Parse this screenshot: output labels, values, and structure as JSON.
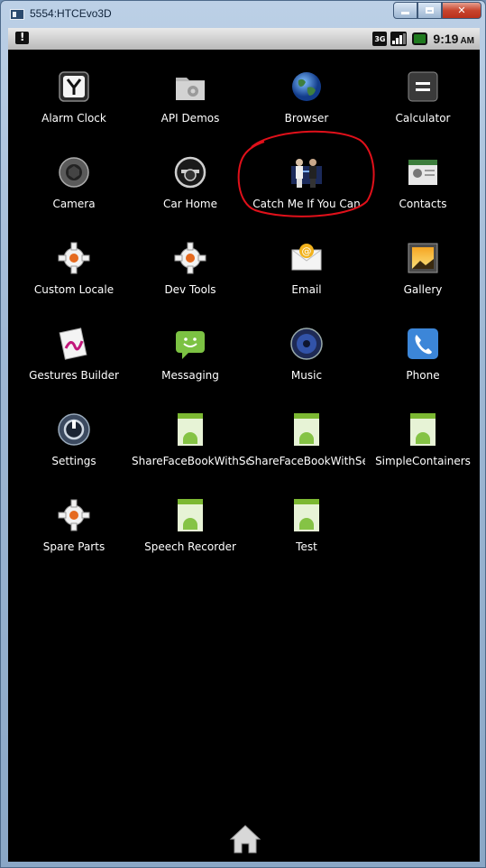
{
  "window": {
    "title": "5554:HTCEvo3D"
  },
  "statusbar": {
    "network_badge": "3G",
    "time": "9:19",
    "ampm": "AM"
  },
  "apps": [
    {
      "label": "Alarm Clock",
      "icon": "alarm-clock-icon"
    },
    {
      "label": "API Demos",
      "icon": "api-demos-icon"
    },
    {
      "label": "Browser",
      "icon": "browser-globe-icon"
    },
    {
      "label": "Calculator",
      "icon": "calculator-icon"
    },
    {
      "label": "Camera",
      "icon": "camera-icon"
    },
    {
      "label": "Car Home",
      "icon": "car-home-icon"
    },
    {
      "label": "Catch Me If You Can",
      "icon": "catch-me-if-you-can-icon"
    },
    {
      "label": "Contacts",
      "icon": "contacts-icon"
    },
    {
      "label": "Custom Locale",
      "icon": "gear-icon"
    },
    {
      "label": "Dev Tools",
      "icon": "gear-icon"
    },
    {
      "label": "Email",
      "icon": "email-icon"
    },
    {
      "label": "Gallery",
      "icon": "gallery-icon"
    },
    {
      "label": "Gestures Builder",
      "icon": "gestures-builder-icon"
    },
    {
      "label": "Messaging",
      "icon": "messaging-icon"
    },
    {
      "label": "Music",
      "icon": "music-speaker-icon"
    },
    {
      "label": "Phone",
      "icon": "phone-icon"
    },
    {
      "label": "Settings",
      "icon": "settings-icon"
    },
    {
      "label": "ShareFaceBookWithSe",
      "icon": "android-default-icon"
    },
    {
      "label": "ShareFaceBookWithSe",
      "icon": "android-default-icon"
    },
    {
      "label": "SimpleContainers",
      "icon": "android-default-icon"
    },
    {
      "label": "Spare Parts",
      "icon": "gear-icon"
    },
    {
      "label": "Speech Recorder",
      "icon": "android-default-icon"
    },
    {
      "label": "Test",
      "icon": "android-default-icon"
    }
  ],
  "colors": {
    "screen_bg": "#000000",
    "annotation": "#e0101a"
  }
}
